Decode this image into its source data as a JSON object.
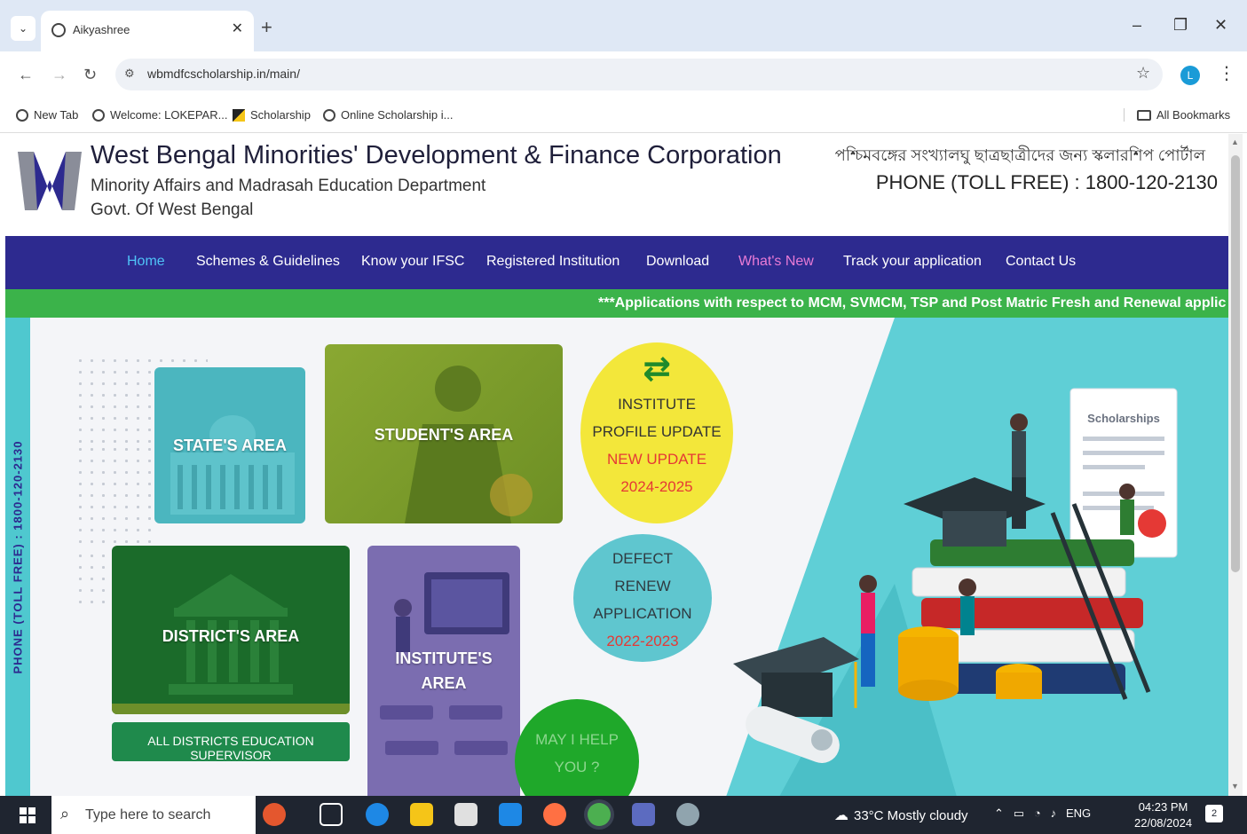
{
  "browser": {
    "tab_title": "Aikyashree",
    "url": "wbmdfcscholarship.in/main/",
    "profile_initial": "L",
    "bookmarks": [
      "New Tab",
      "Welcome: LOKEPAR...",
      "Scholarship",
      "Online Scholarship i..."
    ],
    "all_bookmarks": "All Bookmarks"
  },
  "header": {
    "title": "West Bengal Minorities' Development & Finance Corporation",
    "subtitle1": "Minority Affairs and Madrasah Education Department",
    "subtitle2": "Govt. Of West Bengal",
    "bengali": "পশ্চিমবঙ্গের সংখ্যালঘু ছাত্রছাত্রীদের জন্য স্কলারশিপ পোর্টাল",
    "phone": "PHONE (TOLL FREE) : 1800-120-2130"
  },
  "nav": {
    "items": [
      "Home",
      "Schemes & Guidelines",
      "Know your IFSC",
      "Registered Institution",
      "Download",
      "What's New",
      "Track your application",
      "Contact Us"
    ]
  },
  "ticker": "***Applications with respect to MCM, SVMCM, TSP and Post Matric Fresh and Renewal applic",
  "hero": {
    "vertical_phone": "PHONE (TOLL FREE) : 1800-120-2130",
    "states_area": "STATE'S AREA",
    "students_area": "STUDENT'S AREA",
    "districts_area": "DISTRICT'S AREA",
    "districts_supervisor": "ALL DISTRICTS EDUCATION SUPERVISOR",
    "institutes_area_1": "INSTITUTE'S",
    "institutes_area_2": "AREA",
    "profile_update": {
      "line1": "INSTITUTE",
      "line2": "PROFILE UPDATE",
      "line3": "NEW UPDATE",
      "line4": "2024-2025"
    },
    "defect_renew": {
      "line1": "DEFECT",
      "line2": "RENEW",
      "line3": "APPLICATION",
      "line4": "2022-2023"
    },
    "help": {
      "line1": "MAY I HELP",
      "line2": "YOU ?"
    },
    "scholarships_doc": "Scholarships"
  },
  "taskbar": {
    "search_placeholder": "Type here to search",
    "weather": "33°C  Mostly cloudy",
    "lang": "ENG",
    "time": "04:23 PM",
    "date": "22/08/2024",
    "notif_count": "2"
  },
  "colors": {
    "navbar": "#2d2a8f",
    "ticker": "#3bb34a",
    "accent_teal": "#4fc8cf",
    "help_green": "#1fa82a"
  }
}
